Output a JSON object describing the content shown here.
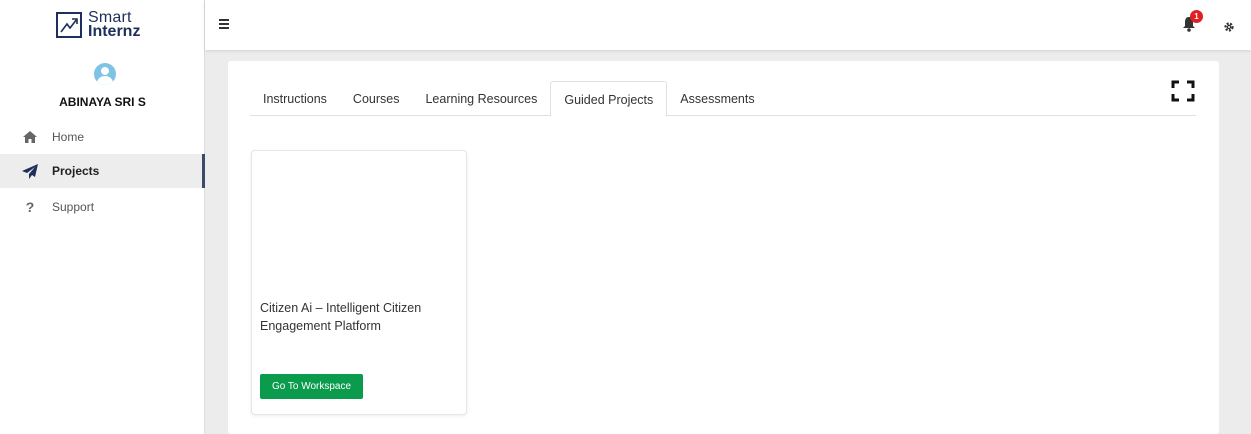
{
  "brand": {
    "line1": "Smart",
    "line2": "Internz"
  },
  "user": {
    "name": "ABINAYA SRI S"
  },
  "sidebar": {
    "items": [
      {
        "label": "Home",
        "icon": "home-icon",
        "active": false
      },
      {
        "label": "Projects",
        "icon": "paper-plane-icon",
        "active": true
      },
      {
        "label": "Support",
        "icon": "question-icon",
        "active": false
      }
    ]
  },
  "topbar": {
    "notification_count": "1"
  },
  "tabs": [
    {
      "label": "Instructions",
      "active": false
    },
    {
      "label": "Courses",
      "active": false
    },
    {
      "label": "Learning Resources",
      "active": false
    },
    {
      "label": "Guided Projects",
      "active": true
    },
    {
      "label": "Assessments",
      "active": false
    }
  ],
  "project": {
    "title": "Citizen Ai – Intelligent Citizen Engagement Platform",
    "button_label": "Go To Workspace"
  },
  "colors": {
    "accent_green": "#0a9b4d",
    "brand_navy": "#1f2f5c",
    "badge_red": "#e02020"
  }
}
